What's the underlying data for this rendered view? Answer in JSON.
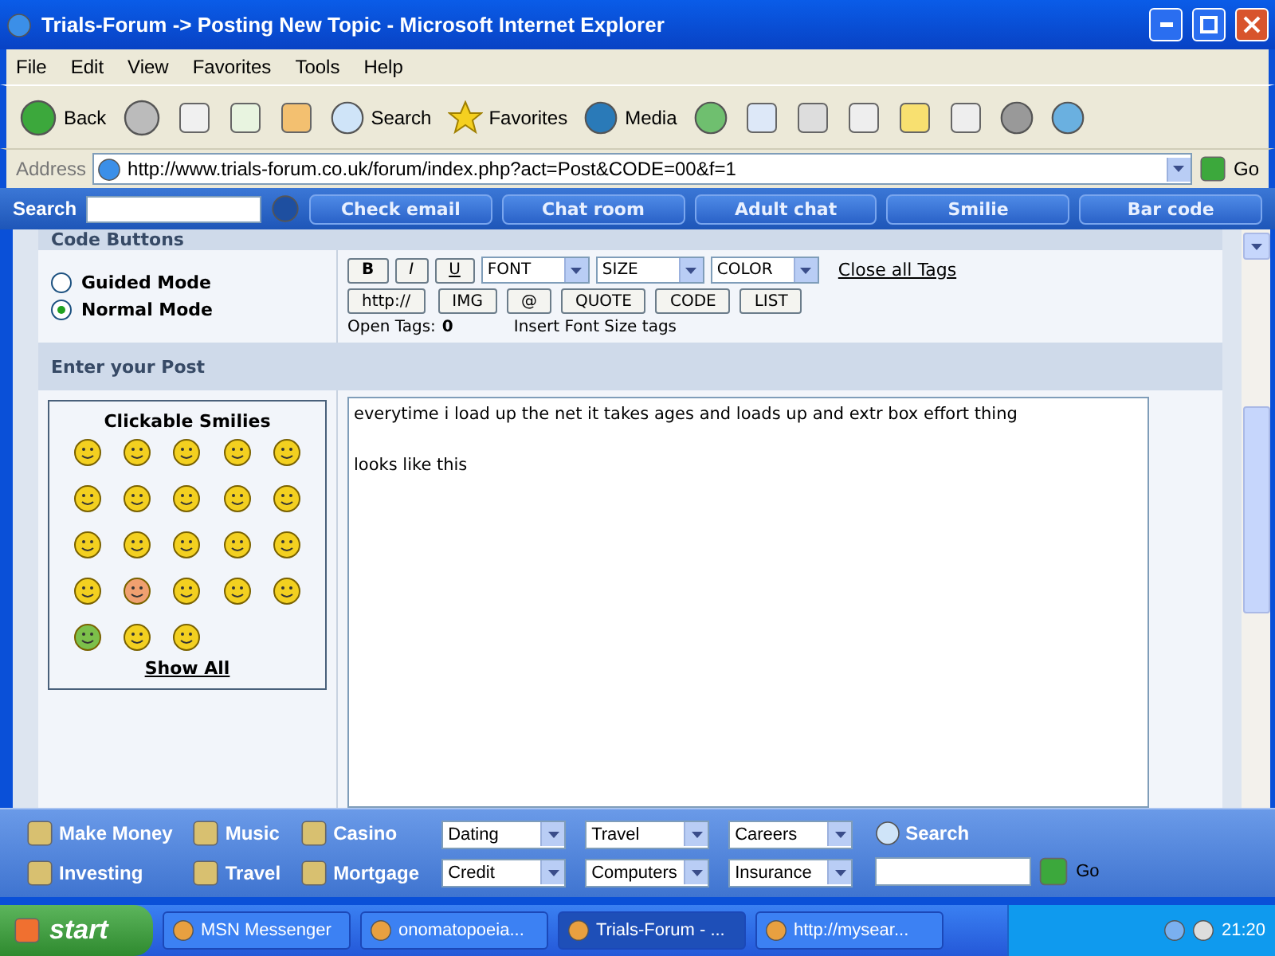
{
  "window": {
    "title": "Trials-Forum -> Posting New Topic - Microsoft Internet Explorer"
  },
  "menu": [
    "File",
    "Edit",
    "View",
    "Favorites",
    "Tools",
    "Help"
  ],
  "toolbar": {
    "back": "Back",
    "search": "Search",
    "favorites": "Favorites",
    "media": "Media"
  },
  "address": {
    "label": "Address",
    "url": "http://www.trials-forum.co.uk/forum/index.php?act=Post&CODE=00&f=1",
    "go": "Go"
  },
  "links_bar": {
    "search_label": "Search",
    "links": [
      "Check email",
      "Chat room",
      "Adult chat",
      "Smilie",
      "Bar code"
    ]
  },
  "code_buttons": {
    "title": "Code Buttons",
    "modes": [
      {
        "label": "Guided Mode",
        "selected": false
      },
      {
        "label": "Normal Mode",
        "selected": true
      }
    ],
    "format_buttons": [
      "B",
      "I",
      "U"
    ],
    "selects": [
      "FONT",
      "SIZE",
      "COLOR"
    ],
    "close_tags": "Close all Tags",
    "tag_buttons": [
      "http://",
      "IMG",
      "@",
      "QUOTE",
      "CODE",
      "LIST"
    ],
    "open_tags_label": "Open Tags:",
    "open_tags_count": "0",
    "hint": "Insert Font Size tags"
  },
  "post": {
    "title": "Enter your Post",
    "smilies_title": "Clickable Smilies",
    "show_all": "Show All",
    "text": "everytime i load up the net it takes ages and loads up and extr box effort thing\n\nlooks like this"
  },
  "bottom_toolbar": {
    "links": [
      "Make Money",
      "Music",
      "Casino",
      "Investing",
      "Travel",
      "Mortgage"
    ],
    "dropdowns": [
      "Dating",
      "Travel",
      "Careers",
      "Credit",
      "Computers",
      "Insurance"
    ],
    "search": "Search",
    "go": "Go"
  },
  "taskbar": {
    "start": "start",
    "tasks": [
      {
        "label": "MSN Messenger",
        "selected": false
      },
      {
        "label": "onomatopoeia...",
        "selected": false
      },
      {
        "label": "Trials-Forum - ...",
        "selected": true
      },
      {
        "label": "http://mysear...",
        "selected": false
      }
    ],
    "clock": "21:20"
  }
}
